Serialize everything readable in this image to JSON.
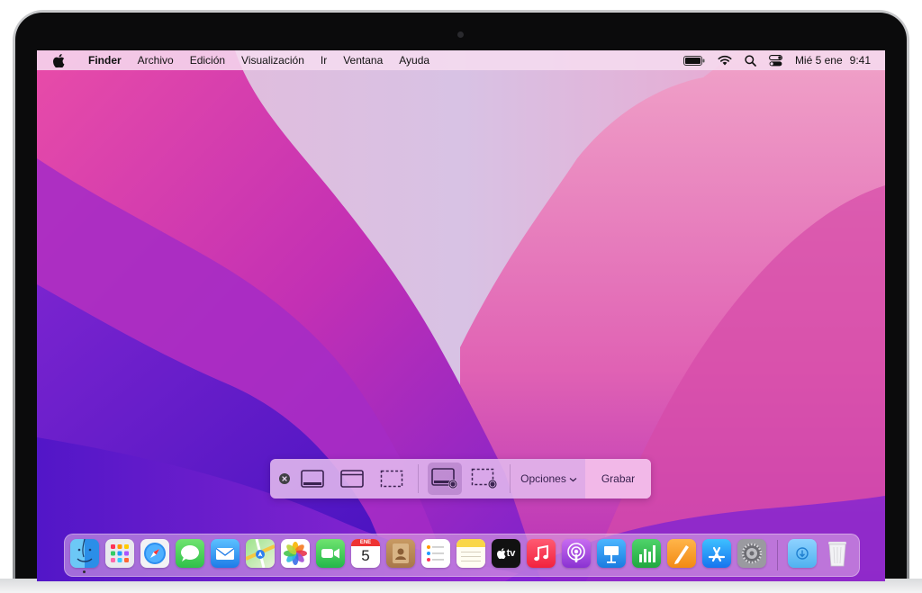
{
  "menubar": {
    "app_name": "Finder",
    "menus": [
      "Archivo",
      "Edición",
      "Visualización",
      "Ir",
      "Ventana",
      "Ayuda"
    ],
    "clock_date": "Mié 5 ene",
    "clock_time": "9:41",
    "status_icons": [
      "battery-icon",
      "wifi-icon",
      "search-icon",
      "control-center-icon"
    ]
  },
  "screenshot_toolbar": {
    "tools": [
      "close-icon",
      "capture-entire-screen-icon",
      "capture-window-icon",
      "capture-selection-icon",
      "record-entire-screen-icon",
      "record-selection-icon"
    ],
    "selected_tool": "record-entire-screen-icon",
    "options_label": "Opciones",
    "record_label": "Grabar"
  },
  "dock": {
    "apps": [
      "finder",
      "launchpad",
      "safari",
      "messages",
      "mail",
      "maps",
      "photos",
      "facetime",
      "calendar",
      "contacts",
      "reminders",
      "notes",
      "tv",
      "music",
      "podcasts",
      "keynote",
      "numbers",
      "pages",
      "app-store",
      "system-preferences",
      "downloads",
      "trash"
    ],
    "calendar_month": "ENE",
    "calendar_day": "5",
    "tv_label": "tv"
  },
  "colors": {
    "menubar_bg": "#f6dcf0",
    "toolbar_bg": "#e2baee",
    "record_bg": "#f2b8e8",
    "wallpaper_primary": "#d23aa4",
    "wallpaper_secondary": "#6a1fd8"
  }
}
